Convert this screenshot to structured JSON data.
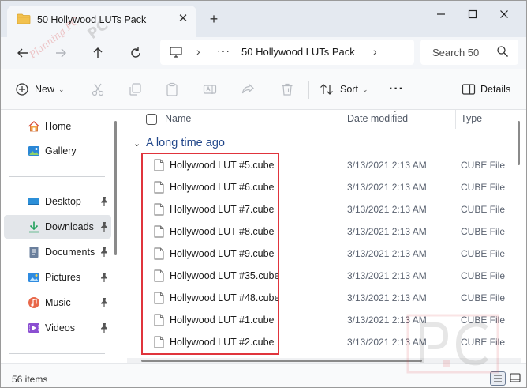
{
  "window": {
    "tab_title": "50 Hollywood LUTs Pack",
    "close_glyph": "✕",
    "add_glyph": "+"
  },
  "address": {
    "path": "50 Hollywood LUTs Pack",
    "dots": "···",
    "search_placeholder": "Search 50"
  },
  "toolbar": {
    "new_label": "New",
    "sort_label": "Sort",
    "more_label": "···",
    "details_label": "Details"
  },
  "sidebar": {
    "items": [
      {
        "label": "Home",
        "icon": "home-icon",
        "pinned": false
      },
      {
        "label": "Gallery",
        "icon": "gallery-icon",
        "pinned": false
      },
      {
        "label": "Desktop",
        "icon": "desktop-icon",
        "pinned": true
      },
      {
        "label": "Downloads",
        "icon": "downloads-icon",
        "pinned": true,
        "selected": true
      },
      {
        "label": "Documents",
        "icon": "documents-icon",
        "pinned": true
      },
      {
        "label": "Pictures",
        "icon": "pictures-icon",
        "pinned": true
      },
      {
        "label": "Music",
        "icon": "music-icon",
        "pinned": true
      },
      {
        "label": "Videos",
        "icon": "videos-icon",
        "pinned": true
      }
    ]
  },
  "columns": {
    "name": "Name",
    "date": "Date modified",
    "type": "Type"
  },
  "group": {
    "label": "A long time ago",
    "chevron": "⌄"
  },
  "files": [
    {
      "name": "Hollywood LUT #5.cube",
      "date": "3/13/2021 2:13 AM",
      "type": "CUBE File"
    },
    {
      "name": "Hollywood LUT #6.cube",
      "date": "3/13/2021 2:13 AM",
      "type": "CUBE File"
    },
    {
      "name": "Hollywood LUT #7.cube",
      "date": "3/13/2021 2:13 AM",
      "type": "CUBE File"
    },
    {
      "name": "Hollywood LUT #8.cube",
      "date": "3/13/2021 2:13 AM",
      "type": "CUBE File"
    },
    {
      "name": "Hollywood LUT #9.cube",
      "date": "3/13/2021 2:13 AM",
      "type": "CUBE File"
    },
    {
      "name": "Hollywood LUT #35.cube",
      "date": "3/13/2021 2:13 AM",
      "type": "CUBE File"
    },
    {
      "name": "Hollywood LUT #48.cube",
      "date": "3/13/2021 2:13 AM",
      "type": "CUBE File"
    },
    {
      "name": "Hollywood LUT #1.cube",
      "date": "3/13/2021 2:13 AM",
      "type": "CUBE File"
    },
    {
      "name": "Hollywood LUT #2.cube",
      "date": "3/13/2021 2:13 AM",
      "type": "CUBE File"
    }
  ],
  "status": {
    "count": "56 items"
  },
  "watermark": {
    "text": "Planning PC",
    "logo": "PC"
  },
  "colors": {
    "accent": "#22478a",
    "highlight": "#e0343c",
    "folder": "#f2c14e"
  }
}
